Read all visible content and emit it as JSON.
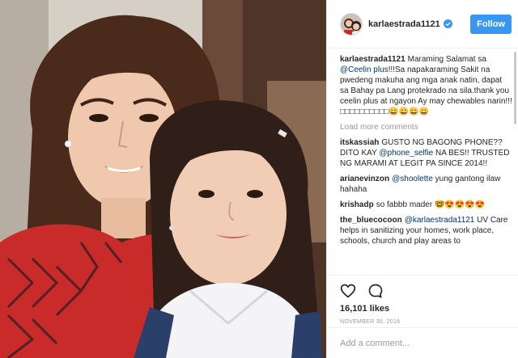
{
  "post": {
    "photo_alt": "",
    "header": {
      "username": "karlaestrada1121",
      "verified_icon": "verified-badge-icon",
      "follow_label": "Follow"
    },
    "caption": {
      "username": "karlaestrada1121",
      "text_before": "Maraming Salamat sa ",
      "mention": "@Ceelin plus",
      "text_after": "!!!Sa napakaraming Sakit na pwedeng makuha ang mga anak natin, dapat sa Bahay pa Lang protekrado na sila.thank you ceelin plus at ngayon Ay may chewables narin!!!□□□□□□□□□□😀😀😀😀"
    },
    "load_more": "Load more comments",
    "comments": [
      {
        "username": "itskassiah",
        "text_before": "GUSTO NG BAGONG PHONE?? DITO KAY ",
        "mention": "@phone_selfie",
        "text_after": " NA BES!! TRUSTED NG MARAMI AT LEGIT PA SINCE 2014!!"
      },
      {
        "username": "arianevinzon",
        "text_before": "",
        "mention": "@shoolette",
        "text_after": " yung gantong ilaw hahaha"
      },
      {
        "username": "krishadp",
        "text_before": "so fabbb mader 🤓😍😍😍😍",
        "mention": "",
        "text_after": ""
      },
      {
        "username": "the_bluecocoon",
        "text_before": "",
        "mention": "@karlaestrada1121",
        "text_after": " UV Care helps in sanitizing your homes, work place, schools, church and play areas to"
      }
    ],
    "icons": {
      "like": "heart-icon",
      "comment": "comment-bubble-icon"
    },
    "likes": "16,101 likes",
    "date": "NOVEMBER 30, 2016",
    "add_comment_placeholder": "Add a comment...",
    "colors": {
      "follow": "#3897f0",
      "mention": "#003569",
      "muted": "#999999",
      "shirt_red": "#c92a2a"
    }
  }
}
